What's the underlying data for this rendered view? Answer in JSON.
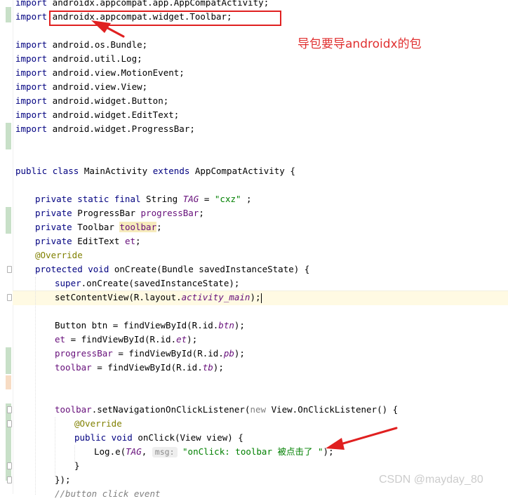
{
  "editor": {
    "lines": {
      "l1": {
        "kw": "import",
        "rest": " androidx.appcompat.app.AppCompatActivity;"
      },
      "l2": {
        "kw": "import",
        "rest": " androidx.appcompat.widget.Toolbar;"
      },
      "l4": {
        "kw": "import",
        "rest": " android.os.Bundle;"
      },
      "l5": {
        "kw": "import",
        "rest": " android.util.Log;"
      },
      "l6": {
        "kw": "import",
        "rest": " android.view.MotionEvent;"
      },
      "l7": {
        "kw": "import",
        "rest": " android.view.View;"
      },
      "l8": {
        "kw": "import",
        "rest": " android.widget.Button;"
      },
      "l9": {
        "kw": "import",
        "rest": " android.widget.EditText;"
      },
      "l10": {
        "kw": "import",
        "rest": " android.widget.ProgressBar;"
      },
      "l13": {
        "kw1": "public",
        "kw2": "class",
        "name": " MainActivity ",
        "kw3": "extends",
        "rest": " AppCompatActivity {"
      },
      "l15": {
        "kw": "private static final",
        "type": " String ",
        "field": "TAG",
        "eq": " = ",
        "str": "\"cxz\"",
        "end": " ;"
      },
      "l16": {
        "kw": "private",
        "type": " ProgressBar ",
        "field": "progressBar",
        "end": ";"
      },
      "l17": {
        "kw": "private",
        "type": " Toolbar ",
        "field": "toolbar",
        "end": ";"
      },
      "l18": {
        "kw": "private",
        "type": " EditText ",
        "field": "et",
        "end": ";"
      },
      "l19": {
        "ann": "@Override"
      },
      "l20": {
        "kw": "protected void",
        "rest": " onCreate(Bundle savedInstanceState) {"
      },
      "l21": {
        "kw": "super",
        "rest": ".onCreate(savedInstanceState);"
      },
      "l22": {
        "pre": "setContentView(R.layout.",
        "field": "activity_main",
        "end": ");"
      },
      "l24": {
        "pre": "Button btn = findViewById(R.id.",
        "field": "btn",
        "end": ");"
      },
      "l25": {
        "field1": "et",
        "pre": " = findViewById(R.id.",
        "field": "et",
        "end": ");"
      },
      "l26": {
        "field1": "progressBar",
        "pre": " = findViewById(R.id.",
        "field": "pb",
        "end": ");"
      },
      "l27": {
        "field1": "toolbar",
        "pre": " = findViewById(R.id.",
        "field": "tb",
        "end": ");"
      },
      "l30": {
        "field1": "toolbar",
        "pre": ".setNavigationOnClickListener(",
        "kw": "new",
        "mid": " View.OnClickListener() {"
      },
      "l31": {
        "ann": "@Override"
      },
      "l32": {
        "kw": "public void",
        "rest": " onClick(View view) {"
      },
      "l33": {
        "pre": "Log.e(",
        "field": "TAG",
        "comma": ", ",
        "hint": "msg:",
        "str": "\"onClick: toolbar 被点击了 \"",
        "end": ");"
      },
      "l34": {
        "text": "}"
      },
      "l35": {
        "text": "});"
      },
      "l36": {
        "cmt": "//button click event"
      }
    }
  },
  "annotation": {
    "note": "导包要导androidx的包",
    "color": "#e03030"
  },
  "watermark": "CSDN @mayday_80"
}
